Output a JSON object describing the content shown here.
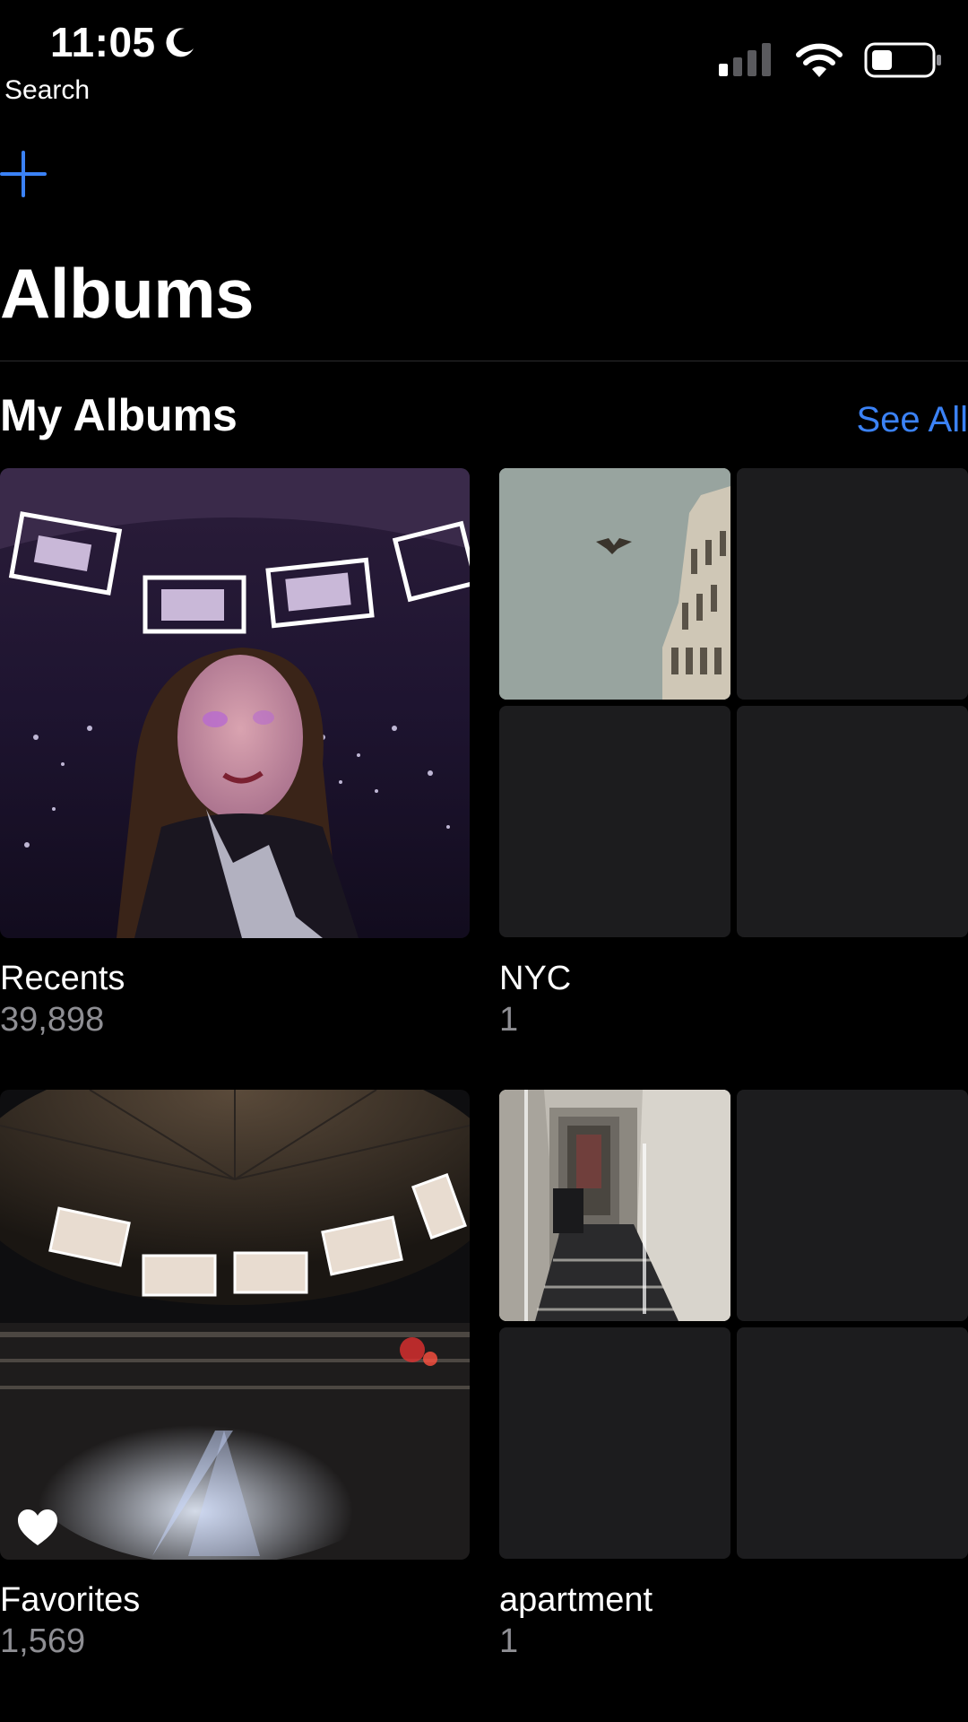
{
  "status_bar": {
    "time": "11:05",
    "back_label": "Search"
  },
  "header": {
    "title": "Albums"
  },
  "section": {
    "title": "My Albums",
    "see_all_label": "See All"
  },
  "albums": [
    {
      "name": "Recents",
      "count": "39,898"
    },
    {
      "name": "NYC",
      "count": "1"
    },
    {
      "name": "Favorites",
      "count": "1,569"
    },
    {
      "name": "apartment",
      "count": "1"
    }
  ],
  "colors": {
    "background": "#000000",
    "accent": "#3b82f6",
    "secondary_text": "#8e8e93",
    "empty_cell": "#1c1c1e"
  },
  "icons": {
    "moon": "moon-icon",
    "signal": "cellular-signal-icon",
    "wifi": "wifi-icon",
    "battery": "battery-icon",
    "add": "plus-icon",
    "favorite": "heart-icon"
  }
}
